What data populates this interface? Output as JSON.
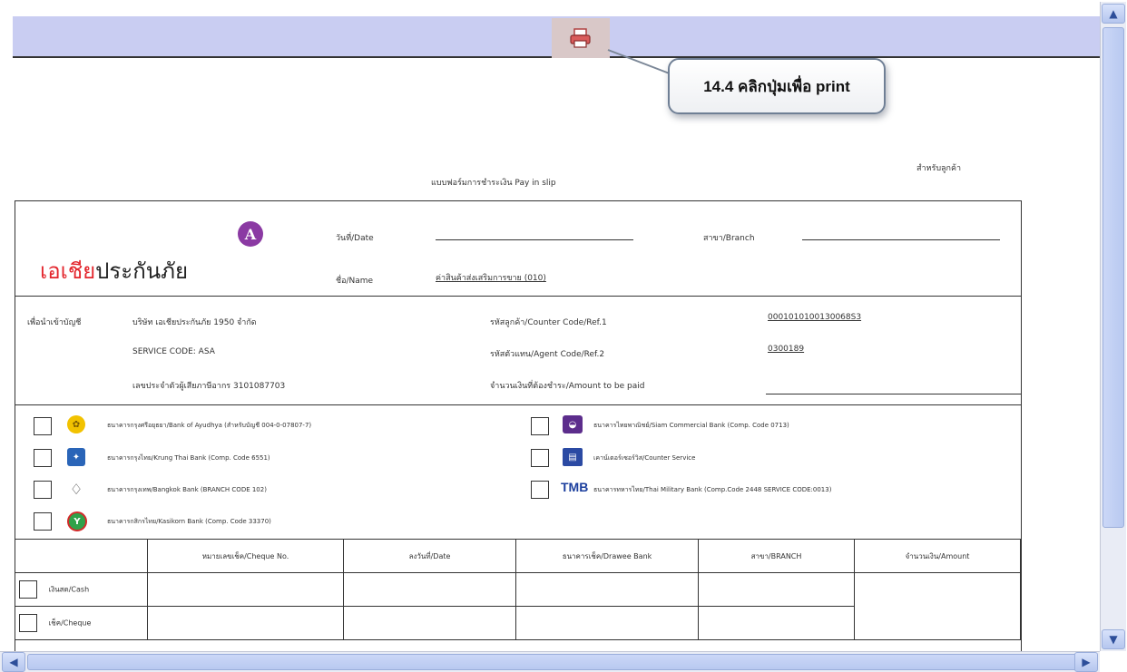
{
  "callout": {
    "text": "14.4 คลิกปุ่มเพื่อ print"
  },
  "form": {
    "title": "แบบฟอร์มการชำระเงิน Pay in slip",
    "copy_for": "สำหรับลูกค้า",
    "date_label": "วันที่/Date",
    "branch_label": "สาขา/Branch",
    "name_label": "ชื่อ/Name",
    "name_value": "ค่าสินค้าส่งเสริมการขาย (010)",
    "logo_text_red": "เอเชีย",
    "logo_text_rest": "ประกันภัย",
    "pay_to_label": "เพื่อนำเข้าบัญชี",
    "company": "บริษัท เอเชียประกันภัย 1950 จำกัด",
    "service_code": "SERVICE CODE: ASA",
    "tax_id": "เลขประจำตัวผู้เสียภาษีอากร 3101087703",
    "counter_code_label": "รหัสลูกค้า/Counter Code/Ref.1",
    "counter_code_value": "0001010100130068S3",
    "agent_code_label": "รหัสตัวแทน/Agent Code/Ref.2",
    "agent_code_value": "0300189",
    "amount_label": "จำนวนเงินที่ต้องชำระ/Amount to be paid"
  },
  "banks_left": [
    "ธนาคารกรุงศรีอยุธยา/Bank of Ayudhya (สำหรับบัญชี 004-0-07807-7)",
    "ธนาคารกรุงไทย/Krung Thai Bank (Comp. Code 6551)",
    "ธนาคารกรุงเทพ/Bangkok Bank (BRANCH CODE 102)",
    "ธนาคารกสิกรไทย/Kasikorn Bank (Comp. Code 33370)"
  ],
  "banks_right": [
    "ธนาคารไทยพาณิชย์/Siam Commercial Bank (Comp. Code 0713)",
    "เคาน์เตอร์เซอร์วิส/Counter Service",
    "ธนาคารทหารไทย/Thai Military Bank (Comp.Code 2448 SERVICE CODE:0013)"
  ],
  "pay_table": {
    "headers": [
      "",
      "หมายเลขเช็ค/Cheque No.",
      "ลงวันที่/Date",
      "ธนาคารเช็ค/Drawee Bank",
      "สาขา/BRANCH",
      "จำนวนเงิน/Amount"
    ],
    "rows": [
      "เงินสด/Cash",
      "เช็ค/Cheque"
    ]
  },
  "colors": {
    "toolbar": "#c9cdf2",
    "logo_red": "#e3262d",
    "print_button": "#d9c8c8"
  }
}
